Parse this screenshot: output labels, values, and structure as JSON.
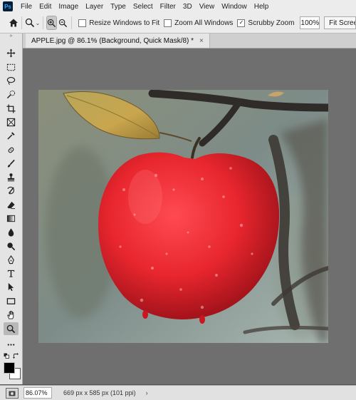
{
  "app": {
    "logo_text": "Ps"
  },
  "menu": [
    "File",
    "Edit",
    "Image",
    "Layer",
    "Type",
    "Select",
    "Filter",
    "3D",
    "View",
    "Window",
    "Help"
  ],
  "options": {
    "resize_windows_label": "Resize Windows to Fit",
    "resize_windows_checked": false,
    "zoom_all_label": "Zoom All Windows",
    "zoom_all_checked": false,
    "scrubby_label": "Scrubby Zoom",
    "scrubby_checked": true,
    "zoom_value": "100%",
    "fit_screen_label": "Fit Screen",
    "active_zoom_mode": "zoom-in"
  },
  "document": {
    "tab_title": "APPLE.jpg @ 86.1% (Background, Quick Mask/8) *",
    "close_glyph": "×"
  },
  "tools": [
    "move-icon",
    "marquee-icon",
    "lasso-icon",
    "quick-selection-icon",
    "crop-icon",
    "frame-icon",
    "eyedropper-icon",
    "healing-brush-icon",
    "brush-icon",
    "clone-stamp-icon",
    "history-brush-icon",
    "eraser-icon",
    "gradient-icon",
    "blur-icon",
    "dodge-icon",
    "pen-icon",
    "type-icon",
    "path-selection-icon",
    "rectangle-icon",
    "hand-icon",
    "zoom-icon",
    "more-tools-icon"
  ],
  "active_tool": "zoom-icon",
  "colors": {
    "foreground": "#000000",
    "background": "#ffffff",
    "apple": "#e8262e",
    "accent": "#31a8ff"
  },
  "status": {
    "zoom": "86.07%",
    "doc_info": "669 px x 585 px (101 ppi)",
    "arrow": "›"
  }
}
